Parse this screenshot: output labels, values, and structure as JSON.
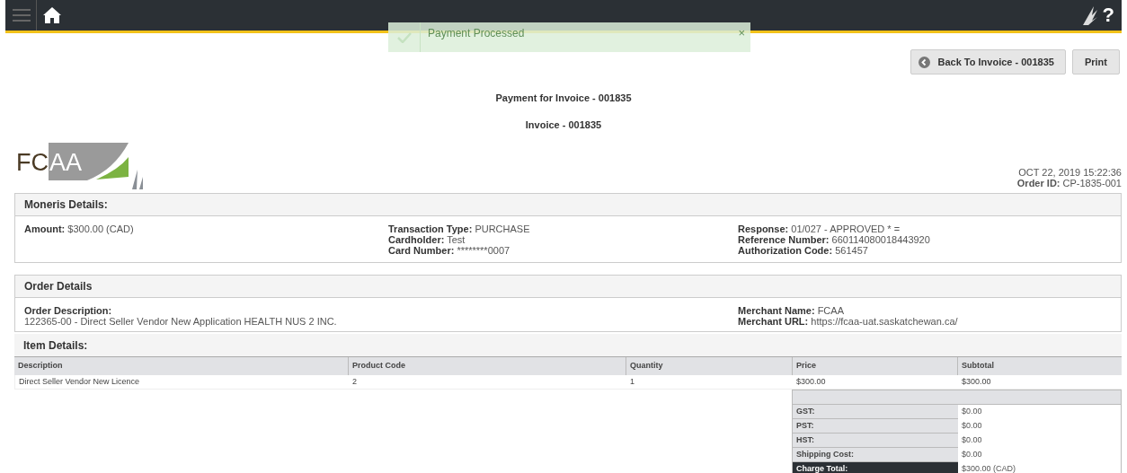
{
  "top_bar": {
    "help": "?"
  },
  "toast": {
    "message": "Payment Processed",
    "close": "×"
  },
  "buttons": [
    {
      "kind": "back",
      "label": "Back To Invoice - 001835"
    },
    {
      "kind": "plain",
      "label": "Print"
    }
  ],
  "headings": [
    "Payment for Invoice - 001835",
    "Invoice - 001835"
  ],
  "logo": {
    "dark": "FC",
    "light": "AA"
  },
  "date": "OCT 22, 2019 15:22:36",
  "order_id": "**Order ID:** CP-1835-001",
  "moneris": {
    "title": "Moneris Details:",
    "columns": [
      [
        {
          "label": "Amount:",
          "value": "$300.00 (CAD)"
        }
      ],
      [
        {
          "label": "Transaction Type:",
          "value": "PURCHASE"
        },
        {
          "label": "Cardholder:",
          "value": "Test"
        },
        {
          "label": "Card Number:",
          "value": "********0007"
        }
      ],
      [
        {
          "label": "Response:",
          "value": "01/027 - APPROVED * ="
        },
        {
          "label": "Reference Number:",
          "value": "660114080018443920"
        },
        {
          "label": "Authorization Code:",
          "value": "561457"
        }
      ]
    ]
  },
  "order": {
    "title": "Order Details",
    "columns": [
      [
        {
          "label": "Order Description:"
        },
        {
          "value": "122365-00 - Direct Seller Vendor New Application HEALTH NUS 2 INC."
        }
      ],
      [],
      [
        {
          "label": "Merchant Name:",
          "value": "FCAA"
        },
        {
          "label": "Merchant URL:",
          "value": "https://fcaa-uat.saskatchewan.ca/"
        }
      ]
    ]
  },
  "items": {
    "title": "Item Details:",
    "columns": [
      "Description",
      "Product Code",
      "Quantity",
      "Price",
      "Subtotal"
    ],
    "rows": [
      [
        "Direct Seller Vendor New Licence",
        "2",
        "1",
        "$300.00",
        "$300.00"
      ]
    ]
  },
  "totals": [
    {
      "label": "GST:",
      "value": "$0.00",
      "kind": "normal"
    },
    {
      "label": "PST:",
      "value": "$0.00",
      "kind": "normal"
    },
    {
      "label": "HST:",
      "value": "$0.00",
      "kind": "normal"
    },
    {
      "label": "Shipping Cost:",
      "value": "$0.00",
      "kind": "normal"
    },
    {
      "label": "Charge Total:",
      "value": "$300.00 (CAD)",
      "kind": "total"
    }
  ]
}
